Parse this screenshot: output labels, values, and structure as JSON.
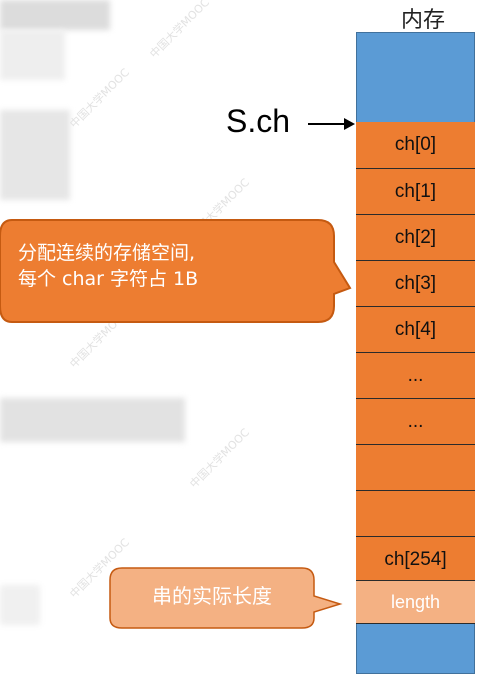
{
  "memory": {
    "title": "内存",
    "pointer_label": "S.ch",
    "cells": [
      "ch[0]",
      "ch[1]",
      "ch[2]",
      "ch[3]",
      "ch[4]",
      "...",
      "...",
      "",
      "",
      "ch[254]"
    ],
    "length_cell": "length"
  },
  "callouts": {
    "storage_line1": "分配连续的存储空间,",
    "storage_line2": "每个 char 字符占 1B",
    "length_note": "串的实际长度"
  },
  "colors": {
    "memory_blue": "#5b9bd5",
    "cell_orange": "#ed7d31",
    "length_cell": "#f4b183",
    "callout_orange": "#ed7d31",
    "callout_light": "#f4b183"
  }
}
